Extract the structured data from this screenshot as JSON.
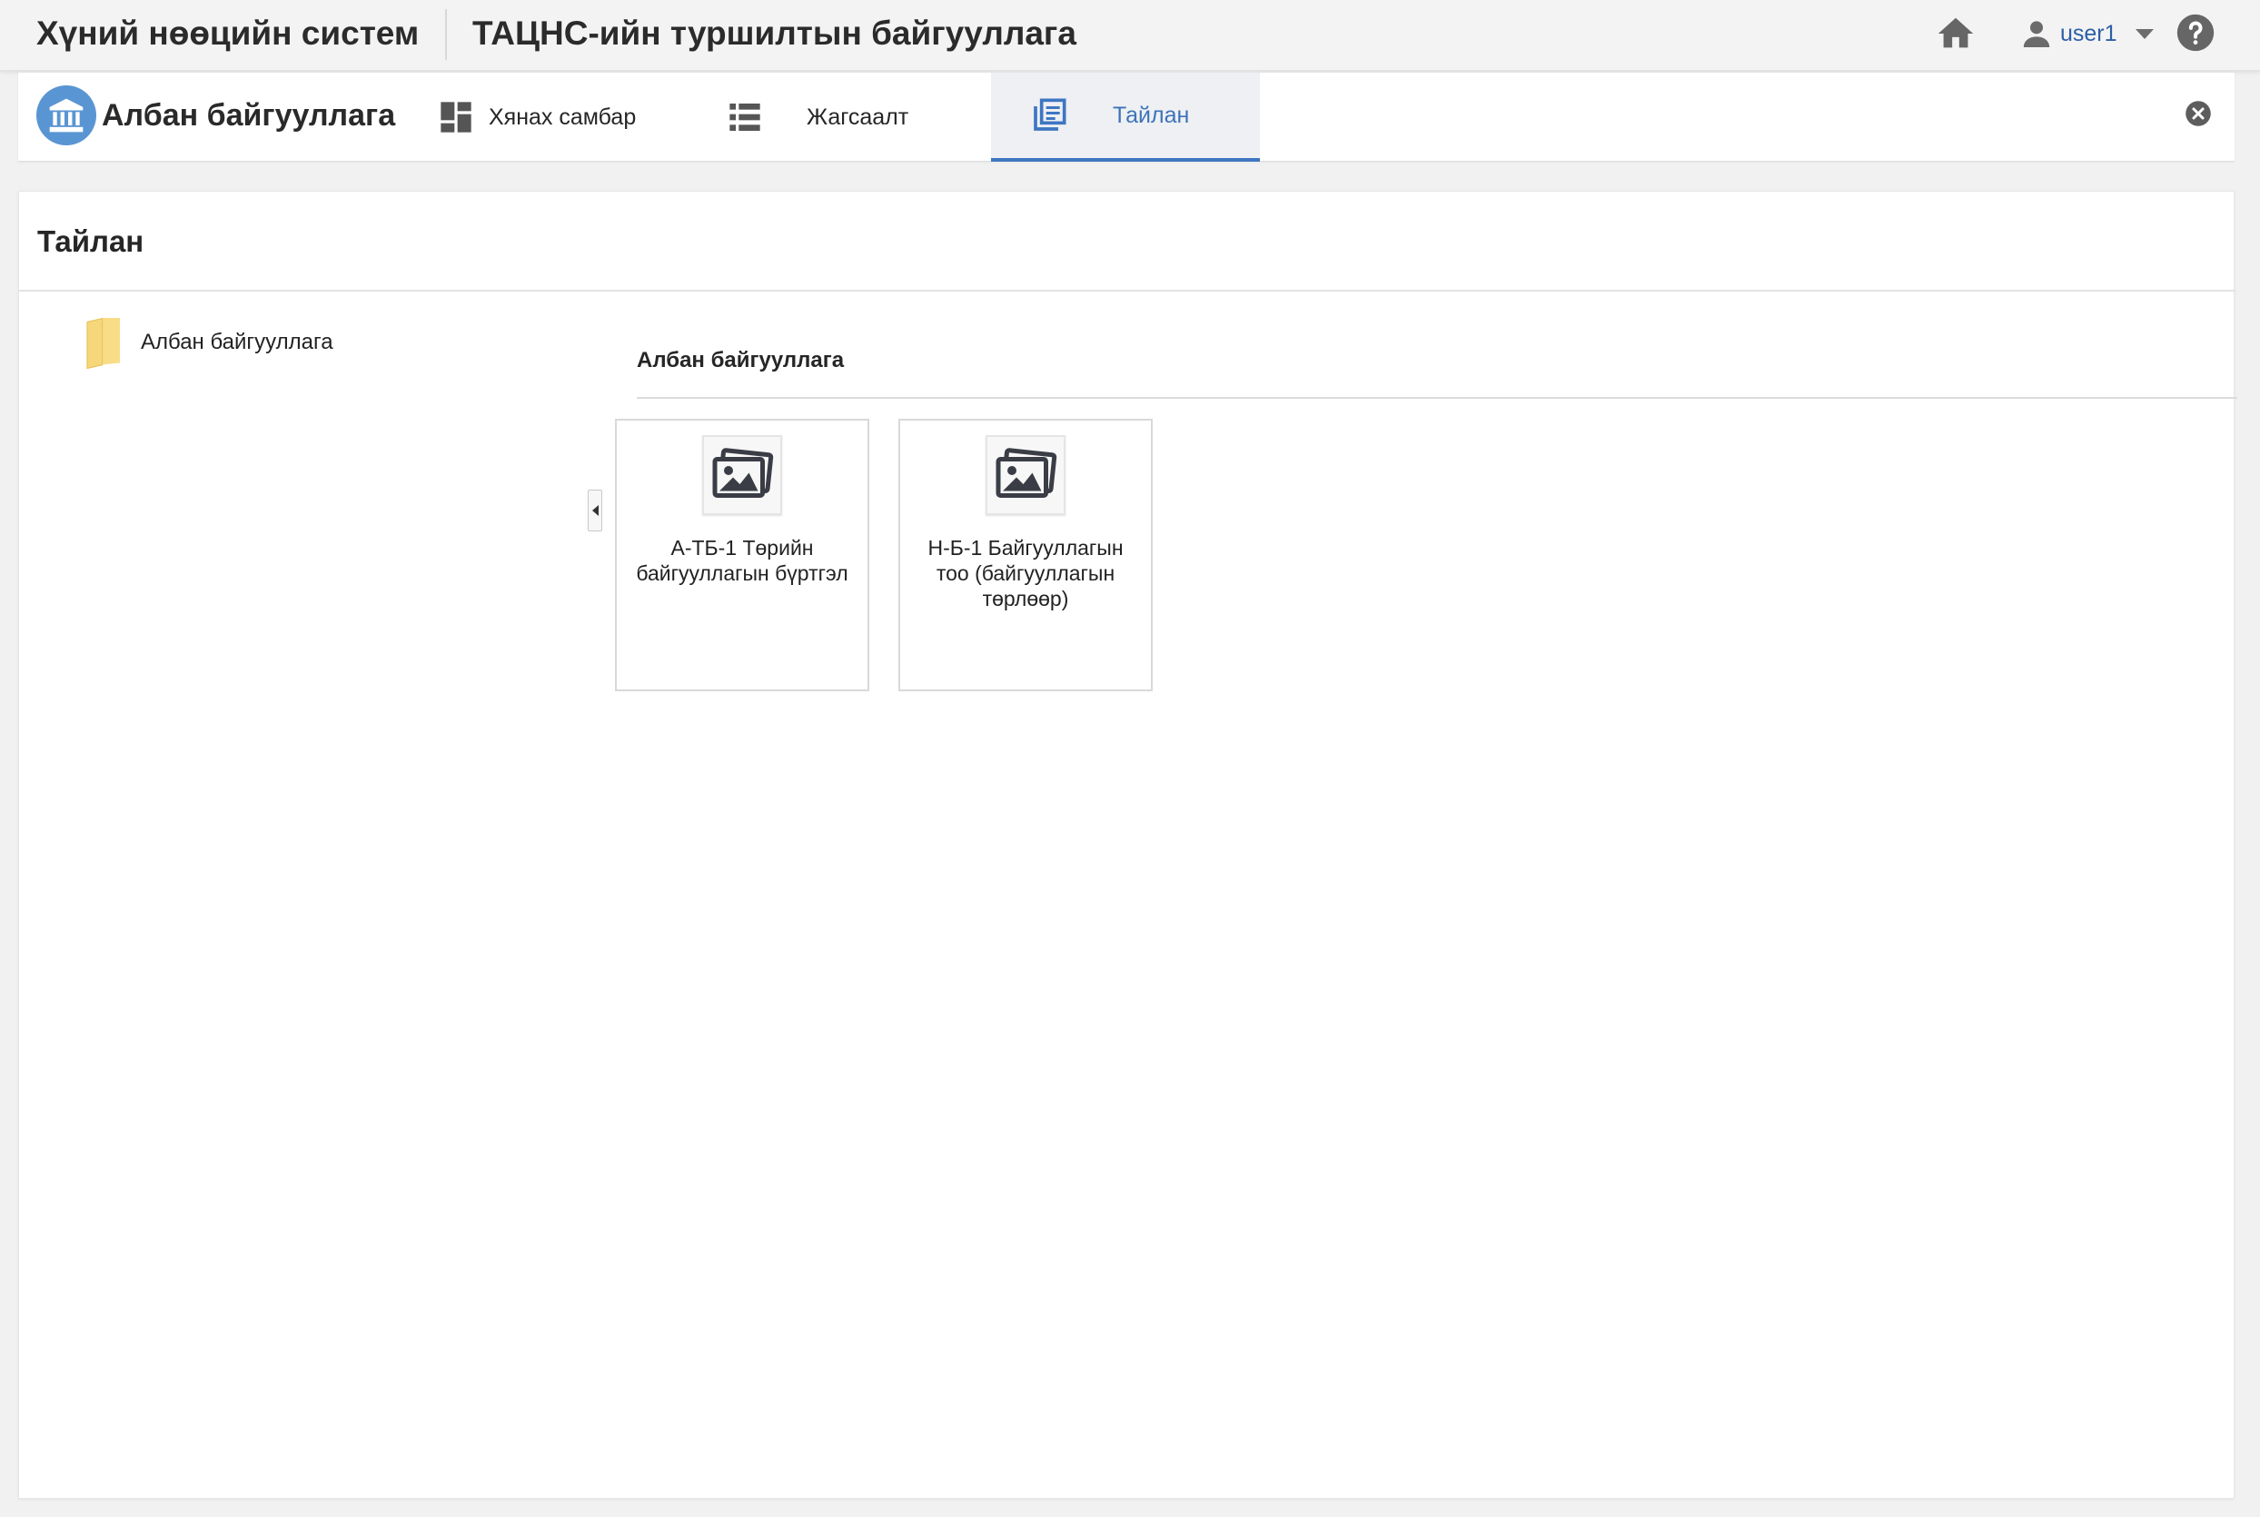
{
  "header": {
    "app_title": "Хүний нөөцийн систем",
    "org_title": "ТАЦНС-ийн туршилтын байгууллага",
    "user_name": "user1",
    "icons": {
      "home": "home-icon",
      "user": "user-icon",
      "help": "help-icon"
    }
  },
  "module_nav": {
    "title": "Албан байгууллага",
    "logo_icon": "bank-building-icon",
    "accent_color": "#3e76c2",
    "tabs": [
      {
        "label": "Хянах самбар",
        "icon": "dashboard-icon",
        "active": false
      },
      {
        "label": "Жагсаалт",
        "icon": "list-icon",
        "active": false
      },
      {
        "label": "Тайлан",
        "icon": "report-icon",
        "active": true
      }
    ]
  },
  "panel": {
    "title": "Тайлан",
    "tree": [
      {
        "label": "Албан байгууллага",
        "icon": "folder-icon"
      }
    ],
    "section_title": "Албан байгууллага",
    "reports": [
      {
        "label": "А-ТБ-1 Төрийн байгууллагын бүртгэл",
        "icon": "image-icon"
      },
      {
        "label": "Н-Б-1 Байгууллагын тоо (байгууллагын төрлөөр)",
        "icon": "image-icon"
      }
    ]
  }
}
